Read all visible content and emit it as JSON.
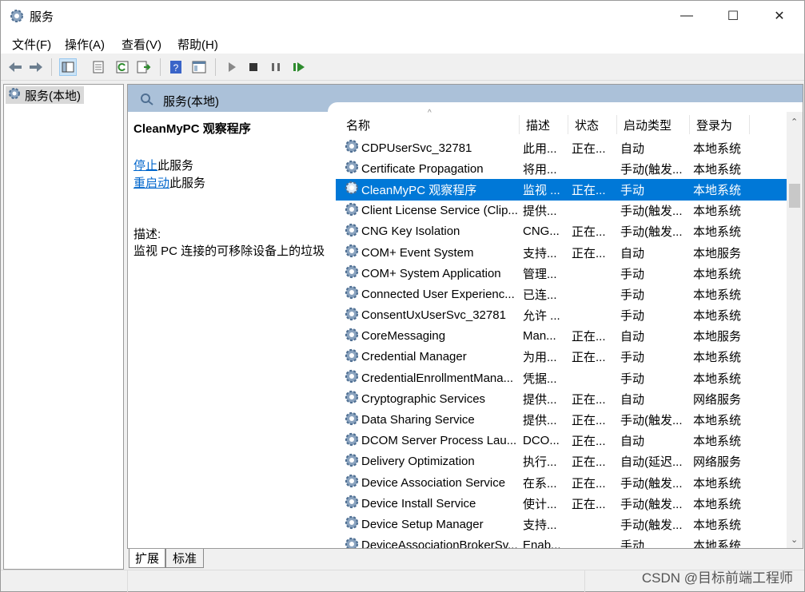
{
  "window": {
    "title": "服务",
    "minimize": "—",
    "maximize": "☐",
    "close": "✕"
  },
  "menu": [
    "文件(F)",
    "操作(A)",
    "查看(V)",
    "帮助(H)"
  ],
  "tree": {
    "root_label": "服务(本地)"
  },
  "pane": {
    "header": "服务(本地)",
    "selected_service": "CleanMyPC 观察程序",
    "stop_link": "停止",
    "stop_suffix": "此服务",
    "restart_link": "重启动",
    "restart_suffix": "此服务",
    "desc_label": "描述:",
    "desc_text": "监视 PC 连接的可移除设备上的垃圾"
  },
  "columns": [
    "名称",
    "描述",
    "状态",
    "启动类型",
    "登录为"
  ],
  "rows": [
    {
      "name": "CDPUserSvc_32781",
      "desc": "此用...",
      "state": "正在...",
      "start": "自动",
      "logon": "本地系统"
    },
    {
      "name": "Certificate Propagation",
      "desc": "将用...",
      "state": "",
      "start": "手动(触发...",
      "logon": "本地系统"
    },
    {
      "name": "CleanMyPC 观察程序",
      "desc": "监视 ...",
      "state": "正在...",
      "start": "手动",
      "logon": "本地系统",
      "selected": true
    },
    {
      "name": "Client License Service (Clip...",
      "desc": "提供...",
      "state": "",
      "start": "手动(触发...",
      "logon": "本地系统"
    },
    {
      "name": "CNG Key Isolation",
      "desc": "CNG...",
      "state": "正在...",
      "start": "手动(触发...",
      "logon": "本地系统"
    },
    {
      "name": "COM+ Event System",
      "desc": "支持...",
      "state": "正在...",
      "start": "自动",
      "logon": "本地服务"
    },
    {
      "name": "COM+ System Application",
      "desc": "管理...",
      "state": "",
      "start": "手动",
      "logon": "本地系统"
    },
    {
      "name": "Connected User Experienc...",
      "desc": "已连...",
      "state": "",
      "start": "手动",
      "logon": "本地系统"
    },
    {
      "name": "ConsentUxUserSvc_32781",
      "desc": "允许 ...",
      "state": "",
      "start": "手动",
      "logon": "本地系统"
    },
    {
      "name": "CoreMessaging",
      "desc": "Man...",
      "state": "正在...",
      "start": "自动",
      "logon": "本地服务"
    },
    {
      "name": "Credential Manager",
      "desc": "为用...",
      "state": "正在...",
      "start": "手动",
      "logon": "本地系统"
    },
    {
      "name": "CredentialEnrollmentMana...",
      "desc": "凭据...",
      "state": "",
      "start": "手动",
      "logon": "本地系统"
    },
    {
      "name": "Cryptographic Services",
      "desc": "提供...",
      "state": "正在...",
      "start": "自动",
      "logon": "网络服务"
    },
    {
      "name": "Data Sharing Service",
      "desc": "提供...",
      "state": "正在...",
      "start": "手动(触发...",
      "logon": "本地系统"
    },
    {
      "name": "DCOM Server Process Lau...",
      "desc": "DCO...",
      "state": "正在...",
      "start": "自动",
      "logon": "本地系统"
    },
    {
      "name": "Delivery Optimization",
      "desc": "执行...",
      "state": "正在...",
      "start": "自动(延迟...",
      "logon": "网络服务"
    },
    {
      "name": "Device Association Service",
      "desc": "在系...",
      "state": "正在...",
      "start": "手动(触发...",
      "logon": "本地系统"
    },
    {
      "name": "Device Install Service",
      "desc": "使计...",
      "state": "正在...",
      "start": "手动(触发...",
      "logon": "本地系统"
    },
    {
      "name": "Device Setup Manager",
      "desc": "支持...",
      "state": "",
      "start": "手动(触发...",
      "logon": "本地系统"
    },
    {
      "name": "DeviceAssociationBrokerSv...",
      "desc": "Enab...",
      "state": "",
      "start": "手动",
      "logon": "本地系统"
    }
  ],
  "bottom_tabs": [
    "扩展",
    "标准"
  ],
  "watermark": "CSDN @目标前端工程师"
}
